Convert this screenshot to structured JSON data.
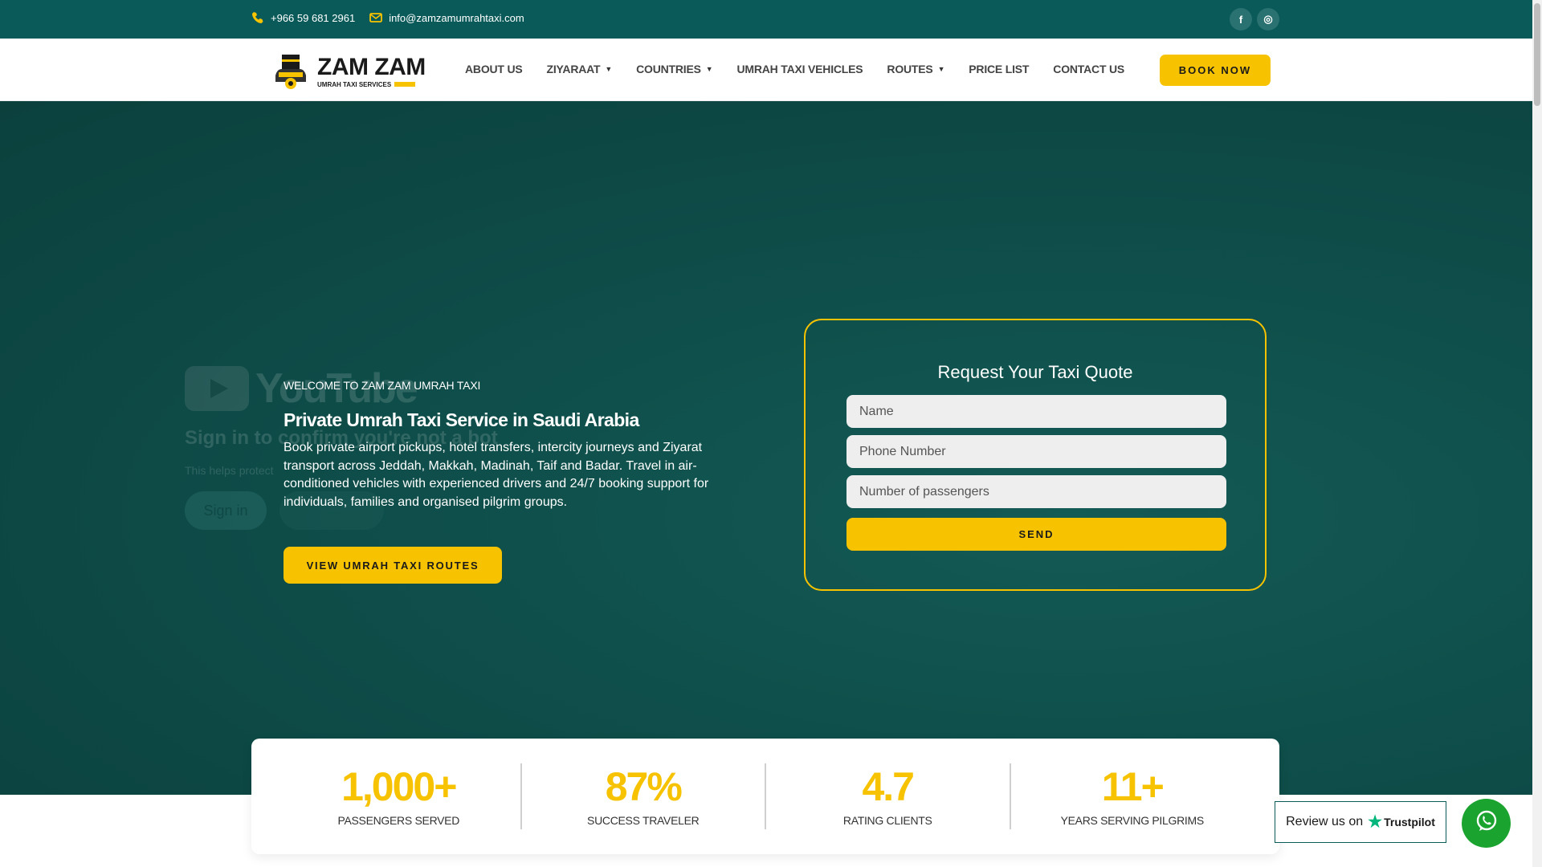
{
  "topbar": {
    "phone": "+966 59 681 2961",
    "email": "info@zamzamumrahtaxi.com",
    "social": [
      {
        "icon": "facebook-icon",
        "label": "f"
      },
      {
        "icon": "instagram-icon",
        "label": "◎"
      }
    ]
  },
  "logo": {
    "brand": "ZAM ZAM",
    "tagline": "UMRAH TAXI SERVICES"
  },
  "nav": {
    "items": [
      {
        "label": "ABOUT US",
        "dropdown": false
      },
      {
        "label": "ZIYARAAT",
        "dropdown": true
      },
      {
        "label": "COUNTRIES",
        "dropdown": true
      },
      {
        "label": "UMRAH TAXI VEHICLES",
        "dropdown": false
      },
      {
        "label": "ROUTES",
        "dropdown": true
      },
      {
        "label": "PRICE LIST",
        "dropdown": false
      },
      {
        "label": "CONTACT US",
        "dropdown": false
      }
    ],
    "book_label": "BOOK NOW",
    "chevron": "▼"
  },
  "youtube_overlay": {
    "wordmark": "YouTube",
    "heading": "Sign in to confirm you're not a bot",
    "helper": "This helps protect",
    "signin": "Sign in"
  },
  "hero": {
    "eyebrow": "WELCOME TO ZAM ZAM UMRAH TAXI",
    "title": "Private Umrah Taxi Service in Saudi Arabia",
    "description": "Book private airport pickups, hotel transfers, intercity journeys and Ziyarat transport across Jeddah, Makkah, Madinah, Taif and Badar. Travel in air-conditioned vehicles with experienced drivers and 24/7 booking support for individuals, families and organised pilgrim groups.",
    "cta": "VIEW UMRAH TAXI ROUTES"
  },
  "quote_form": {
    "title": "Request Your Taxi Quote",
    "name_placeholder": "Name",
    "phone_placeholder": "Phone Number",
    "passengers_placeholder": "Number of passengers",
    "send_label": "SEND"
  },
  "stats": [
    {
      "value": "1,000+",
      "label": "PASSENGERS SERVED"
    },
    {
      "value": "87%",
      "label": "SUCCESS TRAVELER"
    },
    {
      "value": "4.7",
      "label": "RATING CLIENTS"
    },
    {
      "value": "11+",
      "label": "YEARS SERVING PILGRIMS"
    }
  ],
  "trustpilot": {
    "text": "Review us on",
    "brand": "Trustpilot"
  },
  "colors": {
    "teal": "#0b5a5a",
    "yellow": "#f7c300",
    "whatsapp": "#1aa32e"
  }
}
